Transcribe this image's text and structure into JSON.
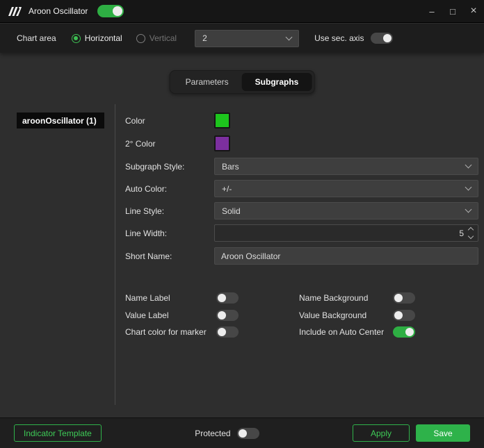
{
  "accent_color": "#2fb24a",
  "titlebar": {
    "title": "Aroon Oscillator",
    "enabled_toggle_on": true,
    "controls": {
      "minimize": "–",
      "maximize": "□",
      "close": "×"
    }
  },
  "icons": {
    "app_logo": "slanted-bars-logo",
    "dropdown_chevron": "chevron-down",
    "number_spinner": "up-down-chevrons"
  },
  "chart_area": {
    "label": "Chart area",
    "horizontal_label": "Horizontal",
    "horizontal_selected": true,
    "vertical_label": "Vertical",
    "vertical_selected": false,
    "areas_value": "2",
    "sec_axis_label": "Use sec. axis",
    "sec_axis_on": false
  },
  "tabs": {
    "parameters": "Parameters",
    "subgraphs": "Subgraphs",
    "active": "Subgraphs"
  },
  "subgraph_list": {
    "selected_item": "aroonOscillator (1)"
  },
  "form": {
    "color": {
      "label": "Color",
      "value": "#1dc51d"
    },
    "color2": {
      "label": "2° Color",
      "value": "#7c2f9f"
    },
    "subgraph_style": {
      "label": "Subgraph Style:",
      "value": "Bars"
    },
    "auto_color": {
      "label": "Auto Color:",
      "value": "+/-"
    },
    "line_style": {
      "label": "Line Style:",
      "value": "Solid"
    },
    "line_width": {
      "label": "Line Width:",
      "value": "5"
    },
    "short_name": {
      "label": "Short Name:",
      "value": "Aroon Oscillator"
    }
  },
  "options": {
    "name_label": {
      "label": "Name Label",
      "on": false
    },
    "name_background": {
      "label": "Name Background",
      "on": false
    },
    "value_label": {
      "label": "Value Label",
      "on": false
    },
    "value_background": {
      "label": "Value Background",
      "on": false
    },
    "chart_color_marker": {
      "label": "Chart color for marker",
      "on": false
    },
    "include_auto_center": {
      "label": "Include on Auto Center",
      "on": true
    }
  },
  "footer": {
    "indicator_template_label": "Indicator Template",
    "protected_label": "Protected",
    "protected_on": false,
    "apply_label": "Apply",
    "save_label": "Save"
  }
}
